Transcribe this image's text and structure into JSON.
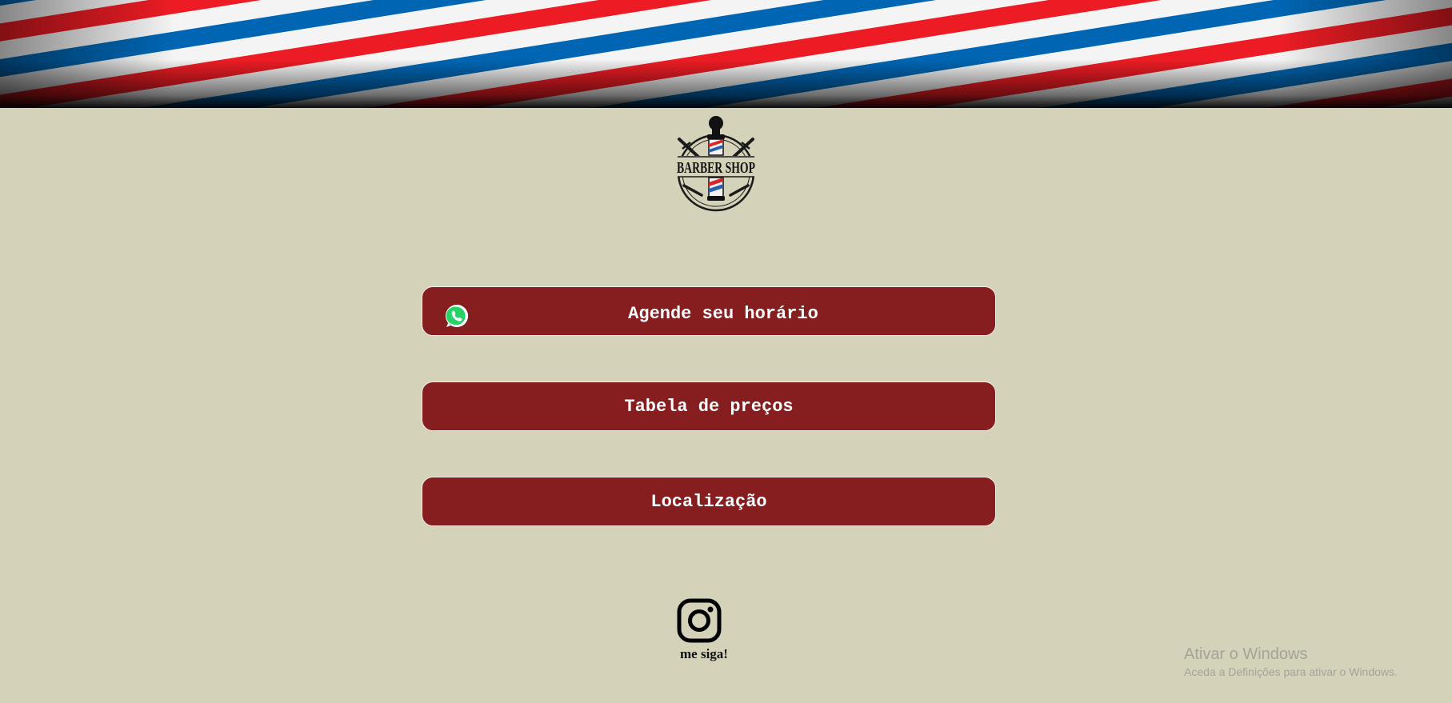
{
  "banner": {
    "stripe_colors": [
      "#ed1c24",
      "#f4f4f4",
      "#0066b3",
      "#f4f4f4"
    ]
  },
  "logo": {
    "text": "BARBER SHOP"
  },
  "buttons": {
    "schedule": {
      "label": "Agende seu horário",
      "icon": "whatsapp-icon"
    },
    "prices": {
      "label": "Tabela de preços"
    },
    "location": {
      "label": "Localização"
    }
  },
  "social": {
    "icon": "instagram-icon",
    "label": "me siga!"
  },
  "watermark": {
    "title": "Ativar o Windows",
    "subtitle": "Aceda a Definições para ativar o Windows."
  },
  "colors": {
    "background": "#d4d3b9",
    "button": "#861d1f",
    "button_text": "#ffffff",
    "whatsapp": "#25d366"
  }
}
